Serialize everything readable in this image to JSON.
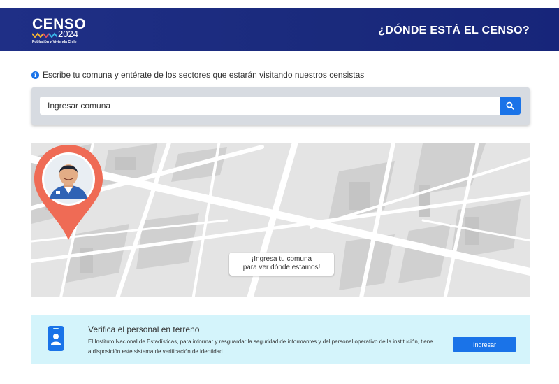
{
  "header": {
    "logo_title": "CENSO",
    "logo_year": "2024",
    "logo_subtitle": "Población y Vivienda Chile",
    "title": "¿DÓNDE ESTÁ EL CENSO?"
  },
  "info": {
    "text": "Escribe tu comuna y entérate de los sectores que estarán visitando nuestros censistas",
    "icon": "info-icon"
  },
  "search": {
    "placeholder": "Ingresar comuna",
    "button_icon": "search-icon"
  },
  "map": {
    "callout_line1": "¡Ingresa tu comuna",
    "callout_line2": "para ver dónde estamos!"
  },
  "verify": {
    "title": "Verifica el personal en terreno",
    "text": "El Instituto Nacional de Estadísticas, para informar y resguardar la seguridad de informantes y del personal operativo de la institución, tiene a disposición este sistema de verificación de identidad.",
    "button_label": "Ingresar",
    "icon": "id-badge-icon"
  },
  "colors": {
    "header": "#1f2f86",
    "accent": "#1a73e8",
    "pin": "#ef6b55",
    "verify_bg": "#d4f4fb"
  }
}
